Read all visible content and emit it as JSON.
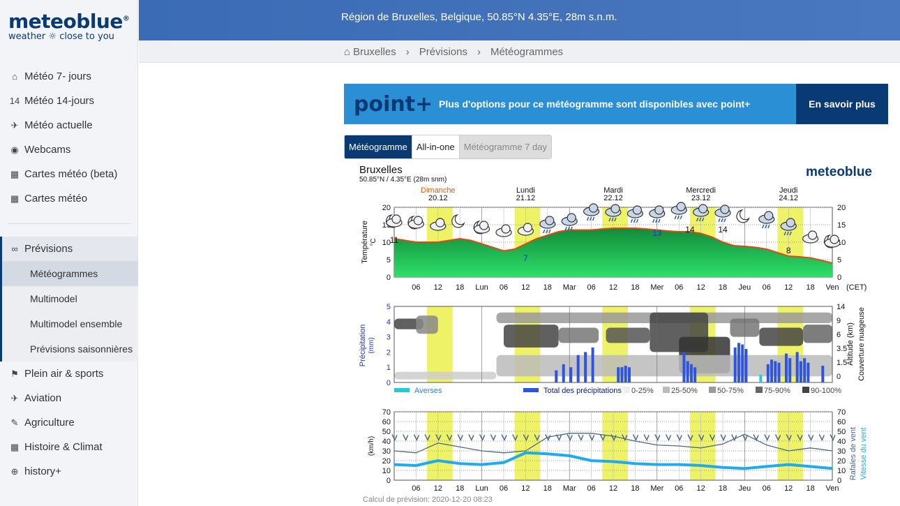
{
  "logo": {
    "name": "meteoblue",
    "tagline": "weather ☼ close to you"
  },
  "nav": {
    "items": [
      {
        "icon": "home-weather-icon",
        "glyph": "⌂",
        "label": "Météo 7- jours"
      },
      {
        "icon": "calendar-14-icon",
        "glyph": "14",
        "label": "Météo 14-jours"
      },
      {
        "icon": "satellite-icon",
        "glyph": "✈",
        "label": "Météo actuelle"
      },
      {
        "icon": "webcam-icon",
        "glyph": "◉",
        "label": "Webcams"
      },
      {
        "icon": "map-icon",
        "glyph": "▦",
        "label": "Cartes météo (beta)"
      },
      {
        "icon": "map-icon",
        "glyph": "▦",
        "label": "Cartes météo"
      }
    ],
    "section": {
      "icon": "binoculars-icon",
      "glyph": "∞",
      "label": "Prévisions"
    },
    "subitems": [
      "Météogrammes",
      "Multimodel",
      "Multimodel ensemble",
      "Prévisions saisonnières"
    ],
    "more": [
      {
        "icon": "hiker-icon",
        "glyph": "⚑",
        "label": "Plein air & sports"
      },
      {
        "icon": "plane-icon",
        "glyph": "✈",
        "label": "Aviation"
      },
      {
        "icon": "pen-icon",
        "glyph": "✎",
        "label": "Agriculture"
      },
      {
        "icon": "calendar-icon",
        "glyph": "▦",
        "label": "Histoire & Climat"
      },
      {
        "icon": "history-plus-icon",
        "glyph": "⊕",
        "label": "history+"
      }
    ]
  },
  "header": {
    "location": "Région de Bruxelles, Belgique, 50.85°N 4.35°E, 28m s.n.m."
  },
  "breadcrumb": [
    "Bruxelles",
    "Prévisions",
    "Météogrammes"
  ],
  "promo": {
    "logo": "point+",
    "text": "Plus d'options pour ce météogramme sont disponibles avec point+",
    "button": "En savoir plus"
  },
  "tabs": [
    "Météogramme",
    "All-in-one",
    "Météogramme 7 day"
  ],
  "meteogram": {
    "place": "Bruxelles",
    "coords": "50.85°N / 4.35°E (28m snm)",
    "brand": "meteoblue",
    "days": [
      {
        "name": "Dimanche",
        "date": "20.12"
      },
      {
        "name": "Lundi",
        "date": "21.12"
      },
      {
        "name": "Mardi",
        "date": "22.12"
      },
      {
        "name": "Mercredi",
        "date": "23.12"
      },
      {
        "name": "Jeudi",
        "date": "24.12"
      }
    ],
    "xticks": [
      "06",
      "12",
      "18",
      "Lun",
      "06",
      "12",
      "18",
      "Mar",
      "06",
      "12",
      "18",
      "Mer",
      "06",
      "12",
      "18",
      "Jeu",
      "06",
      "12",
      "18",
      "Ven"
    ],
    "tz": "(CET)",
    "temp_label": "Température",
    "temp_unit": "°C",
    "precip_label": "Précipitation",
    "precip_unit": "(mm)",
    "alt_label": "Altitude (km)",
    "cloud_label": "Couverture nuageuse",
    "wind_unit": "(km/h)",
    "gust_label": "Rafales de vent",
    "wind_label": "Vitesse du vent",
    "legend_showers": "Averses",
    "legend_total": "Total des précipitations",
    "legend_cloud": [
      "0-25%",
      "25-50%",
      "50-75%",
      "75-90%",
      "90-100%"
    ],
    "calc": "Calcul de prévision: 2020-12-20 08:23"
  },
  "chart_data": [
    {
      "type": "area",
      "title": "Température",
      "ylabel": "°C",
      "ylim": [
        0,
        20
      ],
      "x": [
        0,
        3,
        6,
        9,
        12,
        15,
        18,
        21,
        24,
        27,
        30,
        33,
        36,
        39,
        42,
        45,
        48,
        51,
        54,
        57,
        60,
        63,
        66,
        69,
        72,
        75,
        78,
        81,
        84,
        87,
        90,
        93,
        96,
        99,
        102,
        105,
        108,
        111,
        114,
        117,
        120
      ],
      "series": [
        {
          "values": [
            11,
            10.5,
            10,
            10,
            10,
            10.5,
            11,
            10.5,
            9.5,
            8.5,
            7.5,
            8,
            9.5,
            11,
            12,
            13,
            13.5,
            13.5,
            13.5,
            13.8,
            14,
            14,
            14,
            13.8,
            13.5,
            13.2,
            13,
            13,
            12.5,
            11.5,
            10,
            9,
            8.8,
            8.5,
            8,
            7,
            6,
            5.8,
            5.5,
            4.8,
            4
          ]
        }
      ],
      "labels": [
        11,
        7,
        13,
        14,
        14,
        8
      ]
    },
    {
      "type": "bar",
      "title": "Précipitation",
      "ylabel": "(mm)",
      "ylim": [
        0,
        5
      ],
      "y2label": "Altitude (km)",
      "y2ticks": [
        14,
        9.0,
        6.0,
        3.5,
        1.5,
        0
      ],
      "series": [
        {
          "name": "Total des précipitations",
          "x": [
            44,
            46,
            48,
            50,
            52,
            54,
            61,
            62,
            63,
            64,
            79,
            80,
            81,
            82,
            93,
            94,
            95,
            96,
            102,
            103,
            104,
            105,
            107,
            108,
            110,
            111,
            112,
            113,
            117
          ],
          "values": [
            0.8,
            1.2,
            1.0,
            1.8,
            2.0,
            2.3,
            1.0,
            1.0,
            1.1,
            1.0,
            2.0,
            1.4,
            1.2,
            1.0,
            2.3,
            2.6,
            2.5,
            2.2,
            1.2,
            1.5,
            1.4,
            1.3,
            1.9,
            1.6,
            2.0,
            1.4,
            1.6,
            1.3,
            1.1
          ]
        },
        {
          "name": "Averses",
          "x": [
            100
          ],
          "values": [
            0.5
          ]
        }
      ]
    },
    {
      "type": "line",
      "title": "Vent",
      "ylabel": "(km/h)",
      "ylim": [
        0,
        70
      ],
      "x": [
        0,
        6,
        12,
        18,
        24,
        30,
        36,
        42,
        48,
        54,
        60,
        66,
        72,
        78,
        84,
        90,
        96,
        102,
        108,
        114,
        120
      ],
      "series": [
        {
          "name": "Rafales de vent",
          "values": [
            30,
            28,
            38,
            34,
            30,
            28,
            30,
            44,
            48,
            48,
            45,
            40,
            36,
            35,
            33,
            37,
            47,
            36,
            30,
            33,
            30
          ]
        },
        {
          "name": "Vitesse du vent",
          "values": [
            16,
            15,
            20,
            17,
            16,
            18,
            28,
            27,
            25,
            20,
            19,
            17,
            16,
            16,
            15,
            13,
            12,
            14,
            16,
            14,
            12
          ]
        }
      ]
    }
  ]
}
